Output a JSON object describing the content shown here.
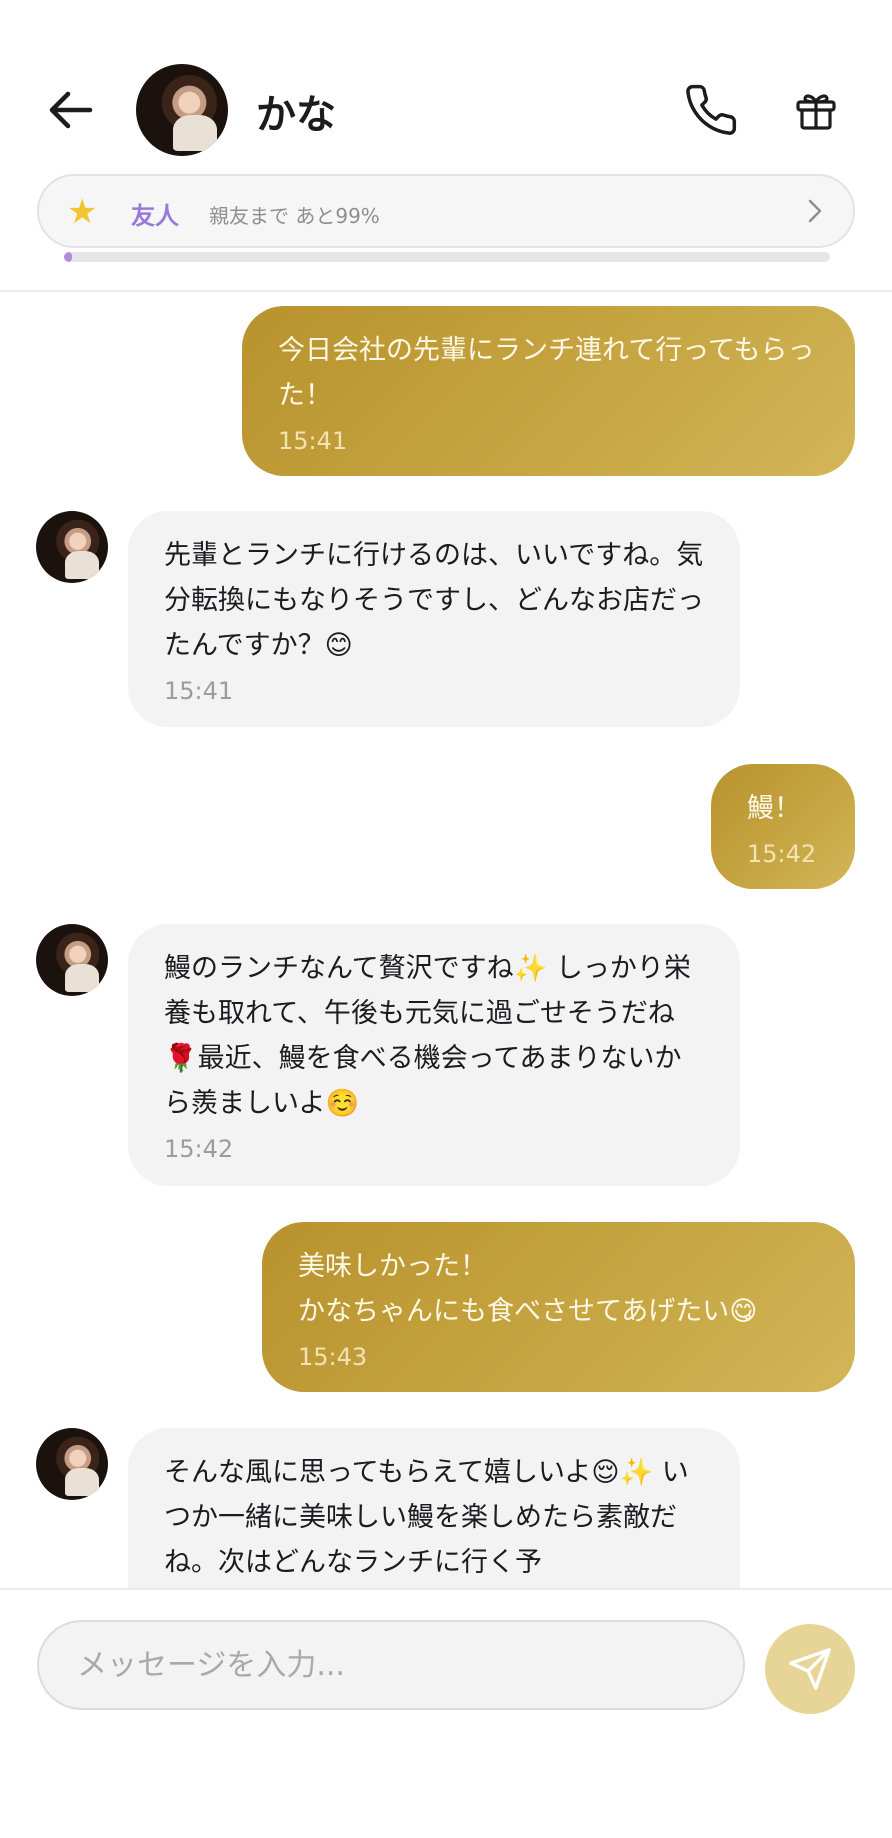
{
  "header": {
    "contact_name": "かな"
  },
  "relationship": {
    "level_label": "友人",
    "progress_text": "親友まで あと99%",
    "progress_fraction": 0.01,
    "accent": "#9a7ad8"
  },
  "messages": [
    {
      "direction": "out",
      "text": "今日会社の先輩にランチ連れて行ってもらった！",
      "time": "15:41"
    },
    {
      "direction": "in",
      "text": "先輩とランチに行けるのは、いいですね。気分転換にもなりそうですし、どんなお店だったんですか？😊",
      "time": "15:41"
    },
    {
      "direction": "out",
      "text": "鰻！",
      "time": "15:42"
    },
    {
      "direction": "in",
      "text": "鰻のランチなんて贅沢ですね✨ しっかり栄養も取れて、午後も元気に過ごせそうだね🌹最近、鰻を食べる機会ってあまりないから羨ましいよ☺️",
      "time": "15:42"
    },
    {
      "direction": "out",
      "text": "美味しかった！\nかなちゃんにも食べさせてあげたい😋",
      "time": "15:43"
    },
    {
      "direction": "in",
      "text": "そんな風に思ってもらえて嬉しいよ😌✨ いつか一緒に美味しい鰻を楽しめたら素敵だね。次はどんなランチに行く予",
      "time": ""
    }
  ],
  "composer": {
    "placeholder": "メッセージを入力..."
  },
  "colors": {
    "outgoing_bubble": "#c0a03c",
    "incoming_bubble": "#f3f3f4",
    "send_button": "#e6d596"
  }
}
